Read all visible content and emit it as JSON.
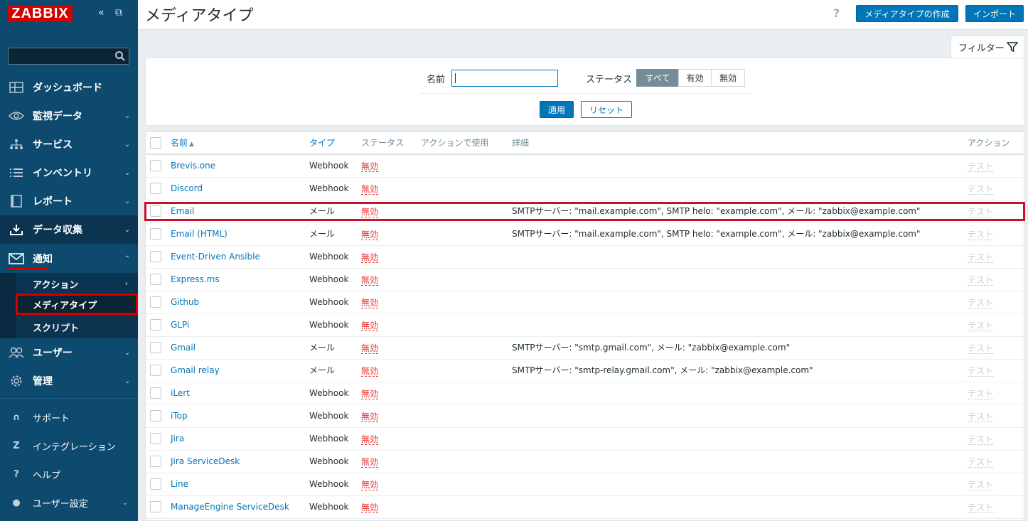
{
  "sidebar": {
    "logo": "ZABBIX",
    "collapse_glyph": "«",
    "expand_glyph": "⧉",
    "search_placeholder": "",
    "nav": [
      {
        "label": "ダッシュボード",
        "icon": "dashboard-icon",
        "has_chevron": false
      },
      {
        "label": "監視データ",
        "icon": "eye-icon",
        "has_chevron": true
      },
      {
        "label": "サービス",
        "icon": "services-icon",
        "has_chevron": true
      },
      {
        "label": "インベントリ",
        "icon": "list-icon",
        "has_chevron": true
      },
      {
        "label": "レポート",
        "icon": "report-icon",
        "has_chevron": true
      },
      {
        "label": "データ収集",
        "icon": "download-icon",
        "has_chevron": true
      },
      {
        "label": "通知",
        "icon": "envelope-icon",
        "has_chevron": true,
        "expanded": true
      }
    ],
    "sub_items": [
      {
        "label": "アクション",
        "has_chevron": true
      },
      {
        "label": "メディアタイプ",
        "selected": true
      },
      {
        "label": "スクリプト"
      }
    ],
    "nav_after": [
      {
        "label": "ユーザー",
        "icon": "users-icon"
      },
      {
        "label": "管理",
        "icon": "gear-icon"
      }
    ],
    "bottom": [
      {
        "label": "サポート",
        "glyph": "∩"
      },
      {
        "label": "インテグレーション",
        "glyph": "Z"
      },
      {
        "label": "ヘルプ",
        "glyph": "?"
      },
      {
        "label": "ユーザー設定",
        "glyph": "●"
      }
    ],
    "chevron_down": "⌄",
    "chevron_up": "⌃",
    "chevron_right": "›"
  },
  "header": {
    "title": "メディアタイプ",
    "help": "?",
    "create_button": "メディアタイプの作成",
    "import_button": "インポート"
  },
  "filter": {
    "tab_label": "フィルター",
    "name_label": "名前",
    "name_value": "",
    "status_label": "ステータス",
    "status_options": [
      "すべて",
      "有効",
      "無効"
    ],
    "status_selected": 0,
    "apply_button": "適用",
    "reset_button": "リセット"
  },
  "table": {
    "columns": {
      "name": "名前",
      "sort_arrow": "▲",
      "type": "タイプ",
      "status": "ステータス",
      "used_in_actions": "アクションで使用",
      "details": "詳細",
      "action": "アクション"
    },
    "rows": [
      {
        "name": "Brevis.one",
        "type": "Webhook",
        "status": "無効",
        "details": "",
        "action": "テスト"
      },
      {
        "name": "Discord",
        "type": "Webhook",
        "status": "無効",
        "details": "",
        "action": "テスト"
      },
      {
        "name": "Email",
        "type": "メール",
        "status": "無効",
        "details": "SMTPサーバー: \"mail.example.com\", SMTP helo: \"example.com\", メール: \"zabbix@example.com\"",
        "action": "テスト"
      },
      {
        "name": "Email (HTML)",
        "type": "メール",
        "status": "無効",
        "details": "SMTPサーバー: \"mail.example.com\", SMTP helo: \"example.com\", メール: \"zabbix@example.com\"",
        "action": "テスト"
      },
      {
        "name": "Event-Driven Ansible",
        "type": "Webhook",
        "status": "無効",
        "details": "",
        "action": "テスト"
      },
      {
        "name": "Express.ms",
        "type": "Webhook",
        "status": "無効",
        "details": "",
        "action": "テスト"
      },
      {
        "name": "Github",
        "type": "Webhook",
        "status": "無効",
        "details": "",
        "action": "テスト"
      },
      {
        "name": "GLPi",
        "type": "Webhook",
        "status": "無効",
        "details": "",
        "action": "テスト"
      },
      {
        "name": "Gmail",
        "type": "メール",
        "status": "無効",
        "details": "SMTPサーバー: \"smtp.gmail.com\", メール: \"zabbix@example.com\"",
        "action": "テスト"
      },
      {
        "name": "Gmail relay",
        "type": "メール",
        "status": "無効",
        "details": "SMTPサーバー: \"smtp-relay.gmail.com\", メール: \"zabbix@example.com\"",
        "action": "テスト"
      },
      {
        "name": "iLert",
        "type": "Webhook",
        "status": "無効",
        "details": "",
        "action": "テスト"
      },
      {
        "name": "iTop",
        "type": "Webhook",
        "status": "無効",
        "details": "",
        "action": "テスト"
      },
      {
        "name": "Jira",
        "type": "Webhook",
        "status": "無効",
        "details": "",
        "action": "テスト"
      },
      {
        "name": "Jira ServiceDesk",
        "type": "Webhook",
        "status": "無効",
        "details": "",
        "action": "テスト"
      },
      {
        "name": "Line",
        "type": "Webhook",
        "status": "無効",
        "details": "",
        "action": "テスト"
      },
      {
        "name": "ManageEngine ServiceDesk",
        "type": "Webhook",
        "status": "無効",
        "details": "",
        "action": "テスト"
      }
    ],
    "highlighted_row": 2
  },
  "colors": {
    "sidebar": "#0e4a6e",
    "accent": "#0275b8",
    "disabled": "#e33734",
    "highlight": "#c8102e"
  }
}
